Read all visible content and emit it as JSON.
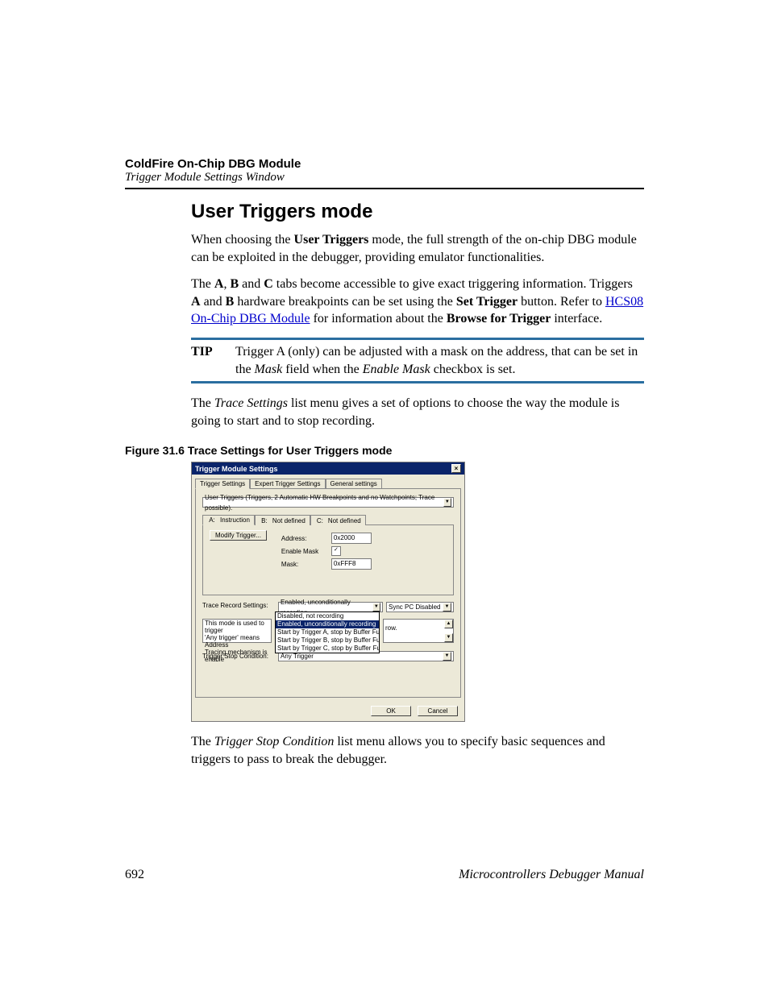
{
  "header": {
    "chapter": "ColdFire On-Chip DBG Module",
    "subtitle": "Trigger Module Settings Window"
  },
  "section_title": "User Triggers mode",
  "para1": {
    "pre": "When choosing the ",
    "b1": "User Triggers",
    "post": " mode, the full strength of the on-chip DBG module can be exploited in the debugger, providing emulator functionalities."
  },
  "para2": {
    "t0": "The ",
    "bA": "A",
    "c1": ", ",
    "bB": "B",
    "c2": " and ",
    "bC": "C",
    "t1": " tabs become accessible to give exact triggering information. Triggers ",
    "bA2": "A",
    "c3": " and ",
    "bB2": "B",
    "t2": " hardware breakpoints can be set using the ",
    "bSet": "Set Trigger",
    "t3": " button. Refer to ",
    "link": "HCS08 On-Chip DBG Module",
    "t4": " for information about the ",
    "bBrowse": "Browse for Trigger",
    "t5": " interface."
  },
  "tip": {
    "label": "TIP",
    "text_pre": "Trigger A (only) can be adjusted with a mask on the address, that can be set in the ",
    "i1": "Mask",
    "mid": " field when the ",
    "i2": "Enable Mask",
    "post": " checkbox is set."
  },
  "para3": {
    "t0": "The ",
    "i1": "Trace Settings",
    "t1": " list menu gives a set of options to choose the way the module is going to start and to stop recording."
  },
  "fig_caption": "Figure 31.6  Trace Settings for User Triggers mode",
  "dialog": {
    "title": "Trigger Module Settings",
    "tabs": [
      "Trigger Settings",
      "Expert Trigger Settings",
      "General settings"
    ],
    "mode_combo": "User Triggers (Triggers, 2 Automatic HW Breakpoints and no Watchpoints; Trace possible).",
    "ttabs": {
      "a_lab": "A:",
      "a_val": "Instruction",
      "b_lab": "B:",
      "b_val": "Not defined",
      "c_lab": "C:",
      "c_val": "Not defined"
    },
    "modify_btn": "Modify Trigger...",
    "addr_label": "Address:",
    "addr_value": "0x2000",
    "mask_enable_label": "Enable Mask",
    "mask_check": "✓",
    "mask_label": "Mask:",
    "mask_value": "0xFFF8",
    "trace_record_label": "Trace Record Settings:",
    "trace_combo": "Enabled, unconditionally recording",
    "sync_combo": "Sync PC Disabled",
    "drop_options": [
      "Disabled, not recording",
      "Enabled, unconditionally recording",
      "Start by Trigger A, stop by Buffer Full",
      "Start by Trigger B, stop by Buffer Full",
      "Start by Trigger C, stop by Buffer Full"
    ],
    "desc_l1": "This mode is used to trigger",
    "desc_l2": "'Any trigger' means Address",
    "desc_l3": "Tracing mechanism is enable",
    "desc_frag": "row.",
    "stop_label": "Trigger Stop Condition:",
    "stop_combo": "Any Trigger",
    "ok": "OK",
    "cancel": "Cancel"
  },
  "para4": {
    "t0": "The ",
    "i1": "Trigger Stop Condition",
    "t1": " list menu allows you to specify basic sequences and triggers to pass to break the debugger."
  },
  "footer": {
    "page": "692",
    "manual": "Microcontrollers Debugger Manual"
  }
}
